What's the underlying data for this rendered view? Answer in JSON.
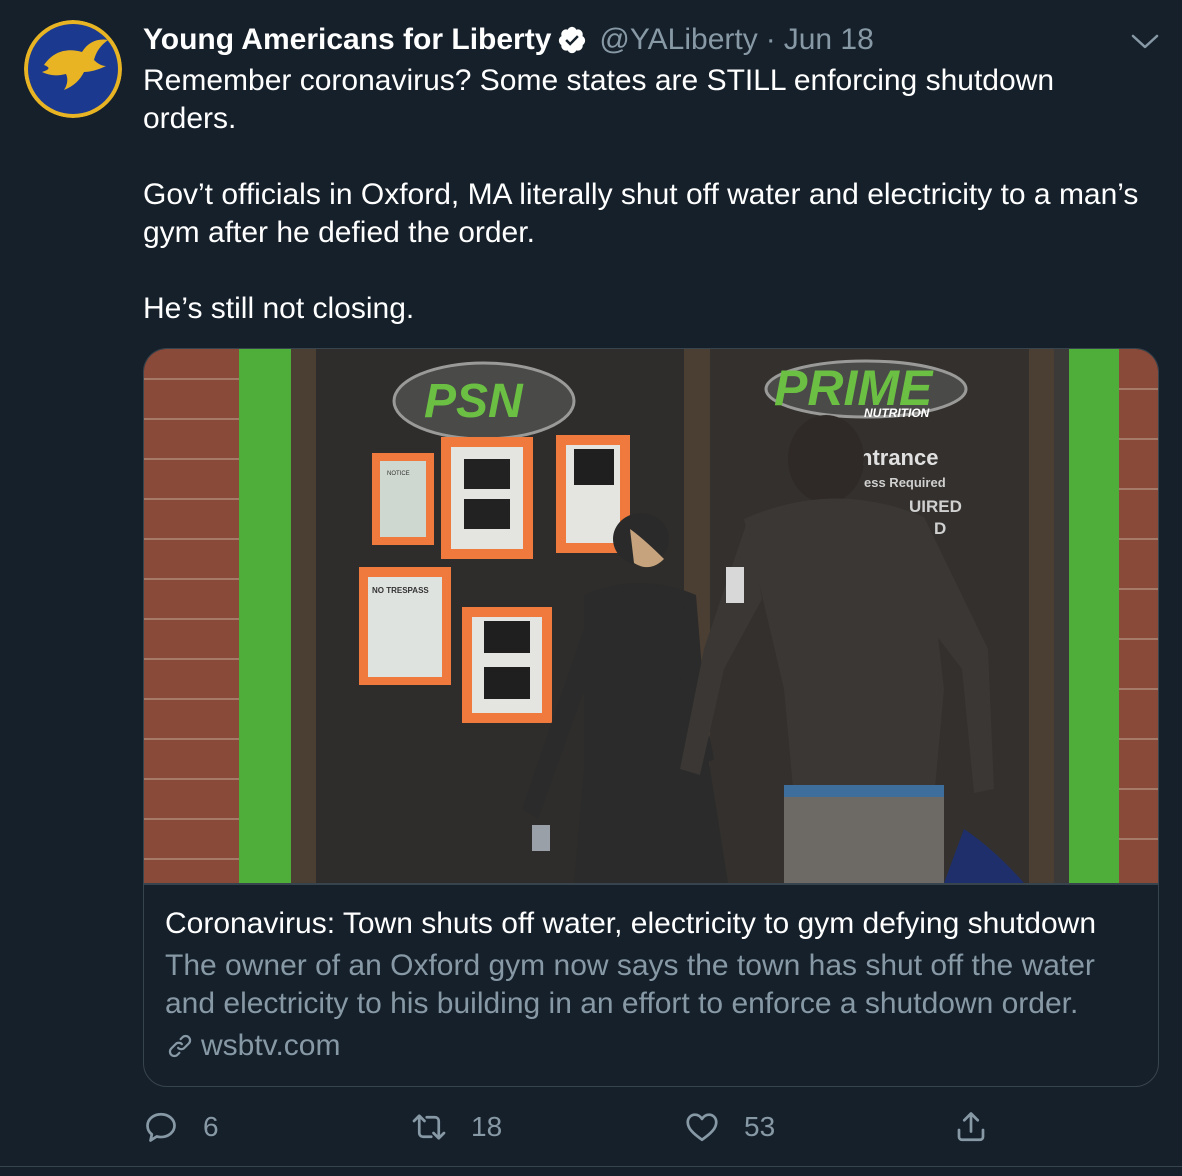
{
  "tweet": {
    "display_name": "Young Americans for Liberty",
    "handle": "@YALiberty",
    "separator": "·",
    "date": "Jun 18",
    "avatar_icon": "eagle-logo-icon",
    "verified_icon": "verified-badge-icon",
    "menu_icon": "chevron-down-icon",
    "body": {
      "line1": "Remember coronavirus? Some states are STILL enforcing shutdown orders.",
      "line2": "Gov’t officials in Oxford, MA literally shut off water and electricity to a man’s gym after he defied the order.",
      "line3": "He’s still not closing."
    }
  },
  "card": {
    "image_description_icon": "news-photo",
    "title": "Coronavirus: Town shuts off water, electricity to gym defying shutdown",
    "description": "The owner of an Oxford gym now says the town has shut off the water and electricity to his building in an effort to enforce a shutdown order.",
    "link_icon": "link-icon",
    "domain": "wsbtv.com",
    "image_text": {
      "left_logo": "PSN",
      "right_logo": "PRIME",
      "right_sub": "NUTRITION",
      "sign1": "ntrance",
      "sign2": "ess Required",
      "sign3": "UIRED",
      "sign4": "D",
      "notice1": "NOTICE",
      "notice2": "NO TRESPASS"
    }
  },
  "actions": {
    "reply": {
      "icon": "reply-icon",
      "count": "6"
    },
    "retweet": {
      "icon": "retweet-icon",
      "count": "18"
    },
    "like": {
      "icon": "heart-icon",
      "count": "53"
    },
    "share": {
      "icon": "share-icon"
    }
  },
  "colors": {
    "background": "#15202b",
    "secondary_text": "#8899a6",
    "border": "#38444d",
    "verified": "#ffffff"
  }
}
